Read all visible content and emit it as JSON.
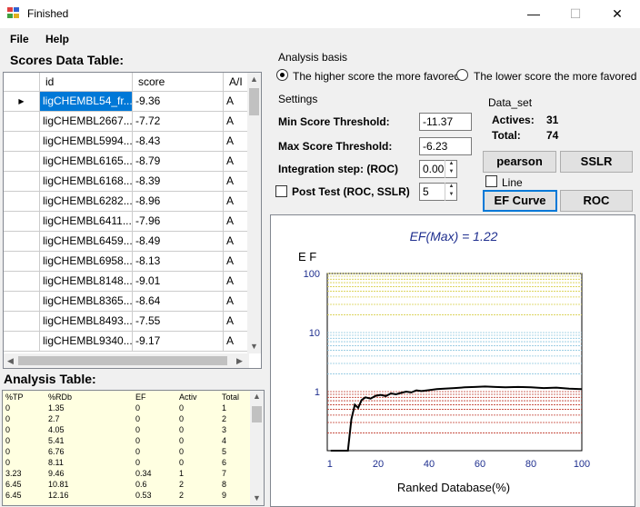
{
  "window": {
    "title": "Finished",
    "min_glyph": "—",
    "max_glyph": "☐",
    "close_glyph": "✕"
  },
  "menu": {
    "file": "File",
    "help": "Help"
  },
  "scores_table": {
    "title": "Scores Data Table:",
    "columns": [
      "id",
      "score",
      "A/I"
    ],
    "rows": [
      {
        "id": "ligCHEMBL54_fr...",
        "score": "-9.36",
        "ai": "A"
      },
      {
        "id": "ligCHEMBL2667...",
        "score": "-7.72",
        "ai": "A"
      },
      {
        "id": "ligCHEMBL5994...",
        "score": "-8.43",
        "ai": "A"
      },
      {
        "id": "ligCHEMBL6165...",
        "score": "-8.79",
        "ai": "A"
      },
      {
        "id": "ligCHEMBL6168...",
        "score": "-8.39",
        "ai": "A"
      },
      {
        "id": "ligCHEMBL6282...",
        "score": "-8.96",
        "ai": "A"
      },
      {
        "id": "ligCHEMBL6411...",
        "score": "-7.96",
        "ai": "A"
      },
      {
        "id": "ligCHEMBL6459...",
        "score": "-8.49",
        "ai": "A"
      },
      {
        "id": "ligCHEMBL6958...",
        "score": "-8.13",
        "ai": "A"
      },
      {
        "id": "ligCHEMBL8148...",
        "score": "-9.01",
        "ai": "A"
      },
      {
        "id": "ligCHEMBL8365...",
        "score": "-8.64",
        "ai": "A"
      },
      {
        "id": "ligCHEMBL8493...",
        "score": "-7.55",
        "ai": "A"
      },
      {
        "id": "ligCHEMBL9340...",
        "score": "-9.17",
        "ai": "A"
      }
    ]
  },
  "analysis_table": {
    "title": "Analysis Table:",
    "columns": [
      "%TP",
      "%RDb",
      "EF",
      "Activ",
      "Total"
    ],
    "rows": [
      [
        "0",
        "1.35",
        "0",
        "0",
        "1"
      ],
      [
        "0",
        "2.7",
        "0",
        "0",
        "2"
      ],
      [
        "0",
        "4.05",
        "0",
        "0",
        "3"
      ],
      [
        "0",
        "5.41",
        "0",
        "0",
        "4"
      ],
      [
        "0",
        "6.76",
        "0",
        "0",
        "5"
      ],
      [
        "0",
        "8.11",
        "0",
        "0",
        "6"
      ],
      [
        "3.23",
        "9.46",
        "0.34",
        "1",
        "7"
      ],
      [
        "6.45",
        "10.81",
        "0.6",
        "2",
        "8"
      ],
      [
        "6.45",
        "12.16",
        "0.53",
        "2",
        "9"
      ]
    ]
  },
  "analysis_basis": {
    "label": "Analysis basis",
    "option_higher": "The higher score the more favored",
    "option_lower": "The lower  score the more favored",
    "selected": "higher"
  },
  "settings": {
    "label": "Settings",
    "min_label": "Min Score Threshold:",
    "min_value": "-11.37",
    "max_label": "Max Score Threshold:",
    "max_value": "-6.23",
    "step_label": "Integration step: (ROC)",
    "step_value": "0.00",
    "post_test_label": "Post Test (ROC, SSLR)",
    "post_test_value": "5"
  },
  "data_set": {
    "label": "Data_set",
    "actives_label": "Actives:",
    "actives_value": "31",
    "total_label": "Total:",
    "total_value": "74"
  },
  "buttons": {
    "pearson": "pearson",
    "sslr": "SSLR",
    "line": "Line",
    "ef_curve": "EF Curve",
    "roc": "ROC"
  },
  "chart_data": {
    "type": "line",
    "title": "EF(Max) = 1.22",
    "ylabel": "E F",
    "xlabel": "Ranked Database(%)",
    "yscale": "log",
    "ylim": [
      0.1,
      100
    ],
    "xlim": [
      0,
      100
    ],
    "x_ticks": [
      "1",
      "20",
      "40",
      "60",
      "80",
      "100"
    ],
    "y_ticks": [
      "100",
      "10",
      "1"
    ],
    "x": [
      1.35,
      2.7,
      4.05,
      5.41,
      6.76,
      8.11,
      9.46,
      10.81,
      12.16,
      13.5,
      15,
      17,
      19,
      21,
      23,
      25,
      27,
      29,
      31,
      33,
      35,
      37,
      40,
      43,
      46,
      50,
      54,
      58,
      62,
      66,
      70,
      75,
      80,
      85,
      90,
      95,
      100
    ],
    "y": [
      0,
      0,
      0,
      0,
      0,
      0,
      0.34,
      0.6,
      0.53,
      0.72,
      0.8,
      0.76,
      0.85,
      0.88,
      0.84,
      0.93,
      0.9,
      0.95,
      1.0,
      0.97,
      1.05,
      1.02,
      1.06,
      1.1,
      1.12,
      1.15,
      1.18,
      1.2,
      1.22,
      1.2,
      1.18,
      1.2,
      1.18,
      1.15,
      1.17,
      1.12,
      1.1
    ],
    "colors": {
      "line": "#000000",
      "title": "#1f2f8f",
      "grid_top": "#d8cf4a",
      "grid_mid": "#8fc7e0",
      "grid_low": "#c0392b"
    }
  }
}
